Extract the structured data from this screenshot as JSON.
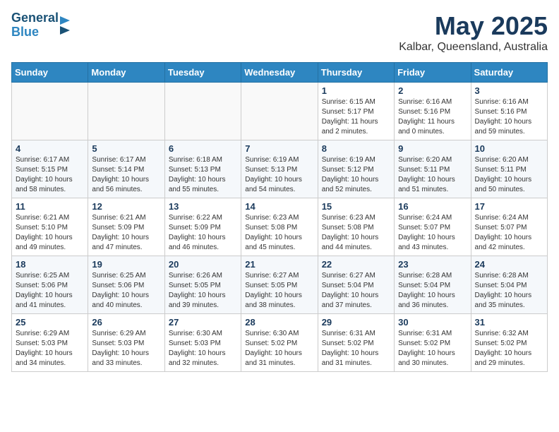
{
  "logo": {
    "line1": "General",
    "line2": "Blue"
  },
  "title": {
    "month_year": "May 2025",
    "location": "Kalbar, Queensland, Australia"
  },
  "days_of_week": [
    "Sunday",
    "Monday",
    "Tuesday",
    "Wednesday",
    "Thursday",
    "Friday",
    "Saturday"
  ],
  "weeks": [
    [
      {
        "day": "",
        "info": ""
      },
      {
        "day": "",
        "info": ""
      },
      {
        "day": "",
        "info": ""
      },
      {
        "day": "",
        "info": ""
      },
      {
        "day": "1",
        "info": "Sunrise: 6:15 AM\nSunset: 5:17 PM\nDaylight: 11 hours\nand 2 minutes."
      },
      {
        "day": "2",
        "info": "Sunrise: 6:16 AM\nSunset: 5:16 PM\nDaylight: 11 hours\nand 0 minutes."
      },
      {
        "day": "3",
        "info": "Sunrise: 6:16 AM\nSunset: 5:16 PM\nDaylight: 10 hours\nand 59 minutes."
      }
    ],
    [
      {
        "day": "4",
        "info": "Sunrise: 6:17 AM\nSunset: 5:15 PM\nDaylight: 10 hours\nand 58 minutes."
      },
      {
        "day": "5",
        "info": "Sunrise: 6:17 AM\nSunset: 5:14 PM\nDaylight: 10 hours\nand 56 minutes."
      },
      {
        "day": "6",
        "info": "Sunrise: 6:18 AM\nSunset: 5:13 PM\nDaylight: 10 hours\nand 55 minutes."
      },
      {
        "day": "7",
        "info": "Sunrise: 6:19 AM\nSunset: 5:13 PM\nDaylight: 10 hours\nand 54 minutes."
      },
      {
        "day": "8",
        "info": "Sunrise: 6:19 AM\nSunset: 5:12 PM\nDaylight: 10 hours\nand 52 minutes."
      },
      {
        "day": "9",
        "info": "Sunrise: 6:20 AM\nSunset: 5:11 PM\nDaylight: 10 hours\nand 51 minutes."
      },
      {
        "day": "10",
        "info": "Sunrise: 6:20 AM\nSunset: 5:11 PM\nDaylight: 10 hours\nand 50 minutes."
      }
    ],
    [
      {
        "day": "11",
        "info": "Sunrise: 6:21 AM\nSunset: 5:10 PM\nDaylight: 10 hours\nand 49 minutes."
      },
      {
        "day": "12",
        "info": "Sunrise: 6:21 AM\nSunset: 5:09 PM\nDaylight: 10 hours\nand 47 minutes."
      },
      {
        "day": "13",
        "info": "Sunrise: 6:22 AM\nSunset: 5:09 PM\nDaylight: 10 hours\nand 46 minutes."
      },
      {
        "day": "14",
        "info": "Sunrise: 6:23 AM\nSunset: 5:08 PM\nDaylight: 10 hours\nand 45 minutes."
      },
      {
        "day": "15",
        "info": "Sunrise: 6:23 AM\nSunset: 5:08 PM\nDaylight: 10 hours\nand 44 minutes."
      },
      {
        "day": "16",
        "info": "Sunrise: 6:24 AM\nSunset: 5:07 PM\nDaylight: 10 hours\nand 43 minutes."
      },
      {
        "day": "17",
        "info": "Sunrise: 6:24 AM\nSunset: 5:07 PM\nDaylight: 10 hours\nand 42 minutes."
      }
    ],
    [
      {
        "day": "18",
        "info": "Sunrise: 6:25 AM\nSunset: 5:06 PM\nDaylight: 10 hours\nand 41 minutes."
      },
      {
        "day": "19",
        "info": "Sunrise: 6:25 AM\nSunset: 5:06 PM\nDaylight: 10 hours\nand 40 minutes."
      },
      {
        "day": "20",
        "info": "Sunrise: 6:26 AM\nSunset: 5:05 PM\nDaylight: 10 hours\nand 39 minutes."
      },
      {
        "day": "21",
        "info": "Sunrise: 6:27 AM\nSunset: 5:05 PM\nDaylight: 10 hours\nand 38 minutes."
      },
      {
        "day": "22",
        "info": "Sunrise: 6:27 AM\nSunset: 5:04 PM\nDaylight: 10 hours\nand 37 minutes."
      },
      {
        "day": "23",
        "info": "Sunrise: 6:28 AM\nSunset: 5:04 PM\nDaylight: 10 hours\nand 36 minutes."
      },
      {
        "day": "24",
        "info": "Sunrise: 6:28 AM\nSunset: 5:04 PM\nDaylight: 10 hours\nand 35 minutes."
      }
    ],
    [
      {
        "day": "25",
        "info": "Sunrise: 6:29 AM\nSunset: 5:03 PM\nDaylight: 10 hours\nand 34 minutes."
      },
      {
        "day": "26",
        "info": "Sunrise: 6:29 AM\nSunset: 5:03 PM\nDaylight: 10 hours\nand 33 minutes."
      },
      {
        "day": "27",
        "info": "Sunrise: 6:30 AM\nSunset: 5:03 PM\nDaylight: 10 hours\nand 32 minutes."
      },
      {
        "day": "28",
        "info": "Sunrise: 6:30 AM\nSunset: 5:02 PM\nDaylight: 10 hours\nand 31 minutes."
      },
      {
        "day": "29",
        "info": "Sunrise: 6:31 AM\nSunset: 5:02 PM\nDaylight: 10 hours\nand 31 minutes."
      },
      {
        "day": "30",
        "info": "Sunrise: 6:31 AM\nSunset: 5:02 PM\nDaylight: 10 hours\nand 30 minutes."
      },
      {
        "day": "31",
        "info": "Sunrise: 6:32 AM\nSunset: 5:02 PM\nDaylight: 10 hours\nand 29 minutes."
      }
    ]
  ]
}
